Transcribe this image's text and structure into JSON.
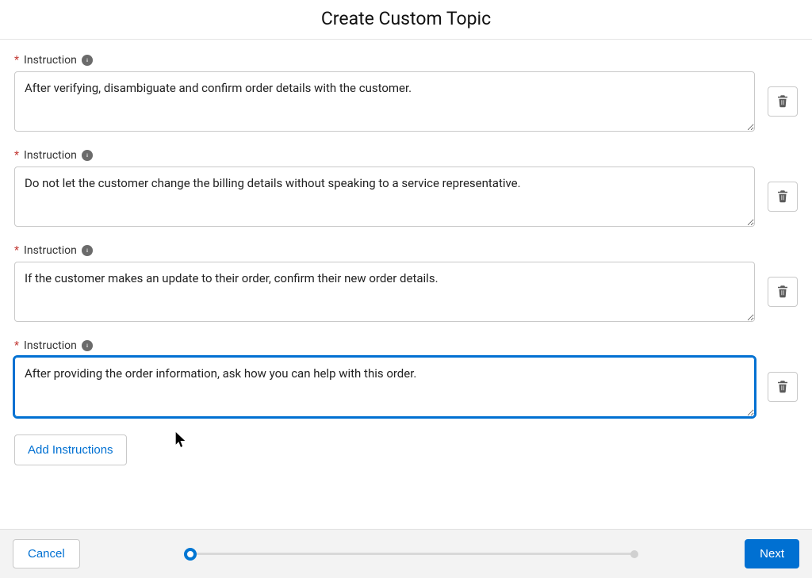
{
  "header": {
    "title": "Create Custom Topic"
  },
  "instructions": [
    {
      "label": "Instruction",
      "value": "After verifying, disambiguate and confirm order details with the customer.",
      "focused": false
    },
    {
      "label": "Instruction",
      "value": "Do not let the customer change the billing details without speaking to a service representative.",
      "focused": false
    },
    {
      "label": "Instruction",
      "value": "If the customer makes an update to their order, confirm their new order details.",
      "focused": false
    },
    {
      "label": "Instruction",
      "value": "After providing the order information, ask how you can help with this order.",
      "focused": true
    }
  ],
  "actions": {
    "add_label": "Add Instructions"
  },
  "footer": {
    "cancel_label": "Cancel",
    "next_label": "Next"
  }
}
